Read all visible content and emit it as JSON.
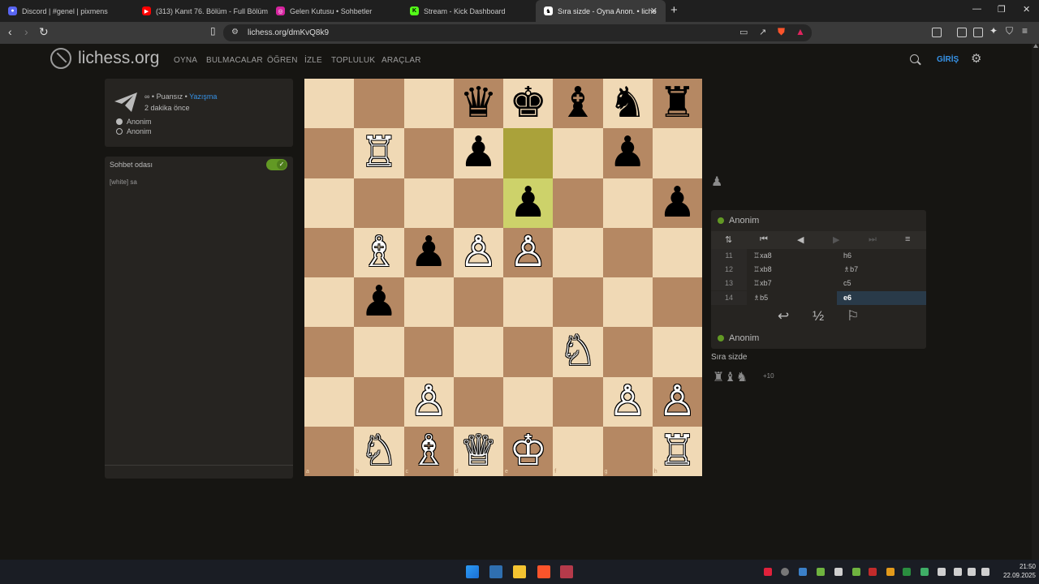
{
  "browser": {
    "tabs": [
      {
        "title": "Discord | #genel | pixmens",
        "color": "#5865f2",
        "icon": "discord-icon"
      },
      {
        "title": "(313) Kanıt 76. Bölüm - Full Bölüm - ",
        "color": "#ff0000",
        "icon": "youtube-icon"
      },
      {
        "title": "Gelen Kutusu • Sohbetler",
        "color": "#d6249f",
        "icon": "instagram-icon"
      },
      {
        "title": "Stream - Kick Dashboard",
        "color": "#53fc18",
        "icon": "kick-icon"
      },
      {
        "title": "Sıra sizde - Oyna Anon. • liche",
        "color": "#ffffff",
        "icon": "lichess-icon",
        "active": true
      }
    ],
    "new_tab": "+",
    "url": "lichess.org/dmKvQ8k9",
    "window_controls": {
      "minimize": "—",
      "maximize": "❐",
      "close": "✕"
    }
  },
  "site": {
    "logo_text": "lichess.org",
    "nav": [
      "OYNA",
      "BULMACALAR",
      "ÖĞREN",
      "İZLE",
      "TOPLULUK",
      "ARAÇLAR"
    ],
    "login": "GİRİŞ"
  },
  "game_info": {
    "mode_prefix": "∞ • Puansız • ",
    "mode_link": "Yazışma",
    "time_ago": "2 dakika önce",
    "players": [
      {
        "name": "Anonim",
        "color": "white"
      },
      {
        "name": "Anonim",
        "color": "black"
      }
    ]
  },
  "chat": {
    "title": "Sohbet odası",
    "enabled": true,
    "messages": [
      {
        "author": "[white]",
        "text": "sa"
      }
    ]
  },
  "board": {
    "files": [
      "a",
      "b",
      "c",
      "d",
      "e",
      "f",
      "g",
      "h"
    ],
    "ranks": [
      "8",
      "7",
      "6",
      "5",
      "4",
      "3",
      "2",
      "1"
    ],
    "last_move": [
      "e7",
      "e6"
    ],
    "pieces": [
      {
        "sq": "d8",
        "glyph": "♛",
        "side": "b"
      },
      {
        "sq": "e8",
        "glyph": "♚",
        "side": "b"
      },
      {
        "sq": "f8",
        "glyph": "♝",
        "side": "b"
      },
      {
        "sq": "g8",
        "glyph": "♞",
        "side": "b"
      },
      {
        "sq": "h8",
        "glyph": "♜",
        "side": "b"
      },
      {
        "sq": "b7",
        "glyph": "♖",
        "side": "w"
      },
      {
        "sq": "d7",
        "glyph": "♟",
        "side": "b"
      },
      {
        "sq": "g7",
        "glyph": "♟",
        "side": "b"
      },
      {
        "sq": "e6",
        "glyph": "♟",
        "side": "b"
      },
      {
        "sq": "h6",
        "glyph": "♟",
        "side": "b"
      },
      {
        "sq": "b5",
        "glyph": "♗",
        "side": "w"
      },
      {
        "sq": "c5",
        "glyph": "♟",
        "side": "b"
      },
      {
        "sq": "d5",
        "glyph": "♙",
        "side": "w"
      },
      {
        "sq": "e5",
        "glyph": "♙",
        "side": "w"
      },
      {
        "sq": "b4",
        "glyph": "♟",
        "side": "b"
      },
      {
        "sq": "f3",
        "glyph": "♘",
        "side": "w"
      },
      {
        "sq": "c2",
        "glyph": "♙",
        "side": "w"
      },
      {
        "sq": "g2",
        "glyph": "♙",
        "side": "w"
      },
      {
        "sq": "h2",
        "glyph": "♙",
        "side": "w"
      },
      {
        "sq": "b1",
        "glyph": "♘",
        "side": "w"
      },
      {
        "sq": "c1",
        "glyph": "♗",
        "side": "w"
      },
      {
        "sq": "d1",
        "glyph": "♕",
        "side": "w"
      },
      {
        "sq": "e1",
        "glyph": "♔",
        "side": "w"
      },
      {
        "sq": "h1",
        "glyph": "♖",
        "side": "w"
      }
    ]
  },
  "right_panel": {
    "captured_top": "♟",
    "top_player": "Anonim",
    "moves": [
      {
        "no": "11",
        "white": "♖xa8",
        "black": "h6"
      },
      {
        "no": "12",
        "white": "♖xb8",
        "black": "♗b7"
      },
      {
        "no": "13",
        "white": "♖xb7",
        "black": "c5"
      },
      {
        "no": "14",
        "white": "♗b5",
        "black": "e6",
        "current": true
      }
    ],
    "draw_label": "½",
    "bottom_player": "Anonim",
    "status": "Sıra sizde",
    "captured_bottom": "♜♝♞",
    "material_diff": "+10"
  },
  "taskbar": {
    "time": "21:50",
    "date": "22.09.2025"
  },
  "colors": {
    "accent": "#3692e7",
    "online": "#629924",
    "board_light": "#f0d9b5",
    "board_dark": "#b58863"
  }
}
